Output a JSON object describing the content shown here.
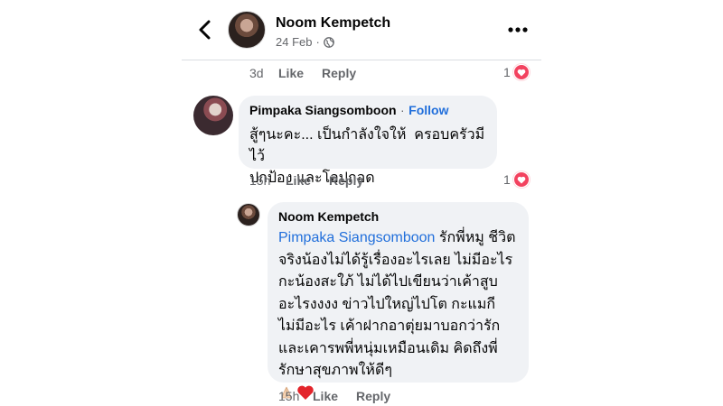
{
  "header": {
    "name": "Noom Kempetch",
    "date": "24 Feb",
    "sep": "·"
  },
  "prev_actions": {
    "time": "3d",
    "like": "Like",
    "reply": "Reply",
    "reaction_count": "1"
  },
  "comment1": {
    "author": "Pimpaka Siangsomboon",
    "sep": "·",
    "follow": "Follow",
    "text": "สู้ๆนะคะ... เป็นกำลังใจให้  ครอบครัวมีไว้\nปกป้อง และโอปกอด",
    "time": "15h",
    "like": "Like",
    "reply": "Reply",
    "reaction_count": "1"
  },
  "reply1": {
    "author": "Noom Kempetch",
    "mention": "Pimpaka Siangsomboon",
    "text": " รักพี่หมู ชีวิตจริงน้องไม่ได้รู้เรื่องอะไรเลย ไม่มีอะไรกะน้องสะใภ้ ไม่ได้ไปเขียนว่าเค้าสูบ อะไรงงงง ข่าวไปใหญ่ไปโต กะแมกีไม่มีอะไร เค้าฝากอาตุ่ยมาบอกว่ารักและเคารพพี่หนุ่มเหมือนเดิม คิดถึงพี่ รักษาสุขภาพให้ดีๆ",
    "emojis": [
      "pray-emoji",
      "heart-emoji"
    ],
    "time": "15h",
    "like": "Like",
    "reply": "Reply"
  },
  "colors": {
    "link": "#216fdb",
    "bubble": "#f0f2f5",
    "meta": "#65676b",
    "heart": "#f3425f"
  }
}
